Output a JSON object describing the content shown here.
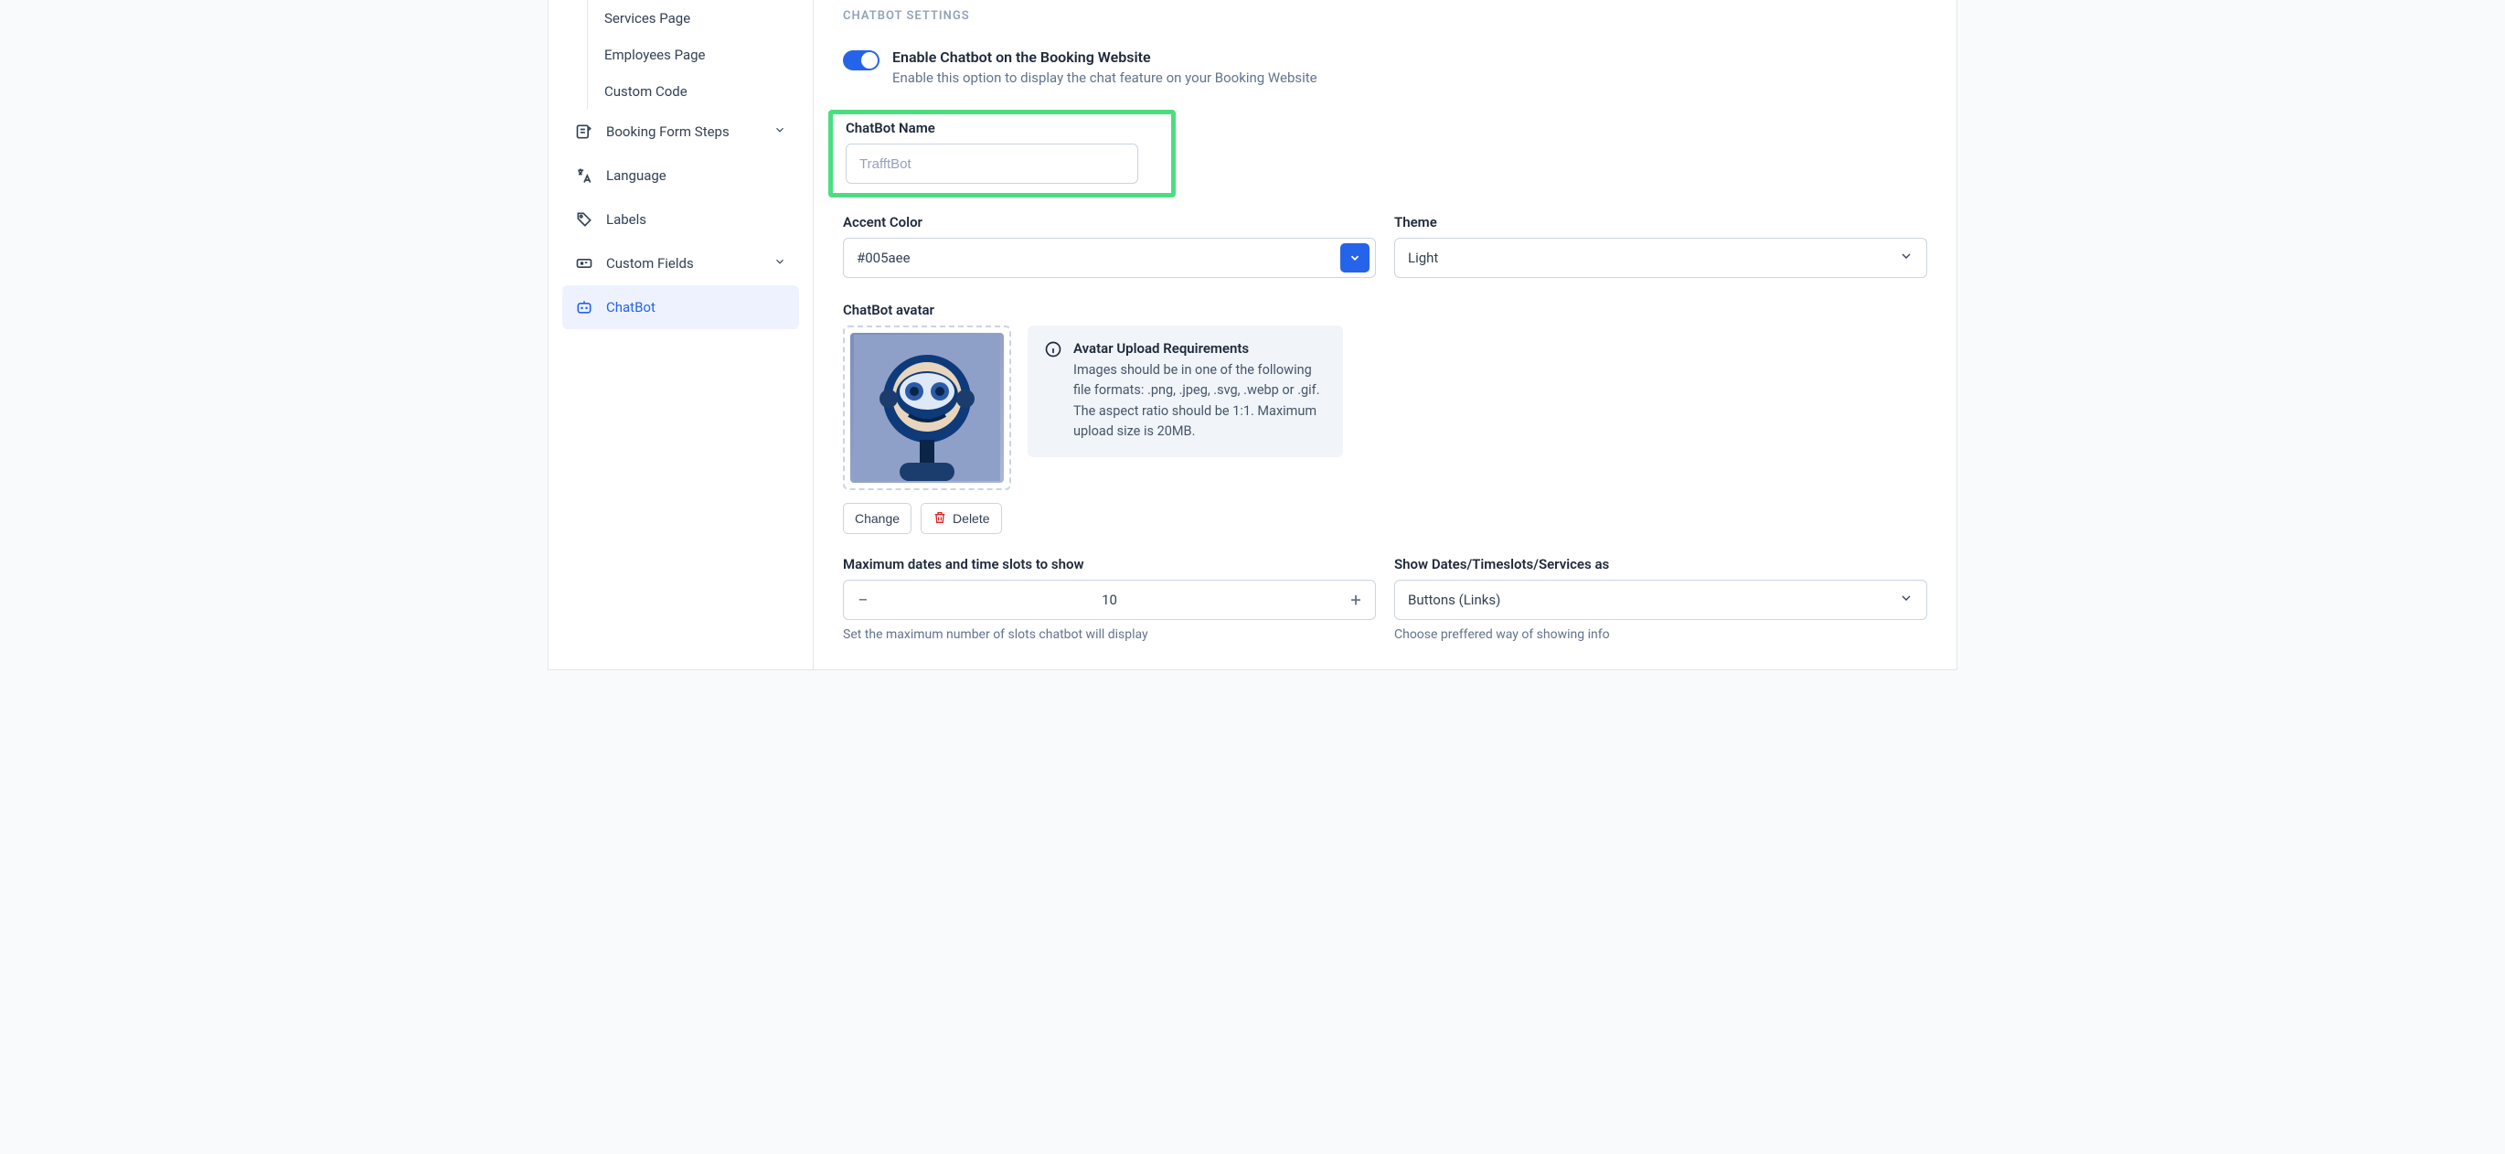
{
  "sidebar": {
    "subItems": [
      "Services Page",
      "Employees Page",
      "Custom Code"
    ],
    "items": [
      {
        "label": "Booking Form Steps",
        "chev": true
      },
      {
        "label": "Language"
      },
      {
        "label": "Labels"
      },
      {
        "label": "Custom Fields",
        "chev": true
      },
      {
        "label": "ChatBot",
        "active": true
      }
    ]
  },
  "main": {
    "sectionTitle": "CHATBOT SETTINGS",
    "enable": {
      "title": "Enable Chatbot on the Booking Website",
      "sub": "Enable this option to display the chat feature on your Booking Website"
    },
    "nameLabel": "ChatBot Name",
    "namePlaceholder": "TrafftBot",
    "accentLabel": "Accent Color",
    "accentValue": "#005aee",
    "themeLabel": "Theme",
    "themeValue": "Light",
    "avatarLabel": "ChatBot avatar",
    "avatarInfoTitle": "Avatar Upload Requirements",
    "avatarInfoDesc": "Images should be in one of the following file formats: .png, .jpeg, .svg, .webp or .gif. The aspect ratio should be 1:1. Maximum upload size is 20MB.",
    "changeBtn": "Change",
    "deleteBtn": "Delete",
    "maxLabel": "Maximum dates and time slots to show",
    "maxValue": "10",
    "maxHelper": "Set the maximum number of slots chatbot will display",
    "showAsLabel": "Show Dates/Timeslots/Services as",
    "showAsValue": "Buttons (Links)",
    "showAsHelper": "Choose preffered way of showing info"
  }
}
